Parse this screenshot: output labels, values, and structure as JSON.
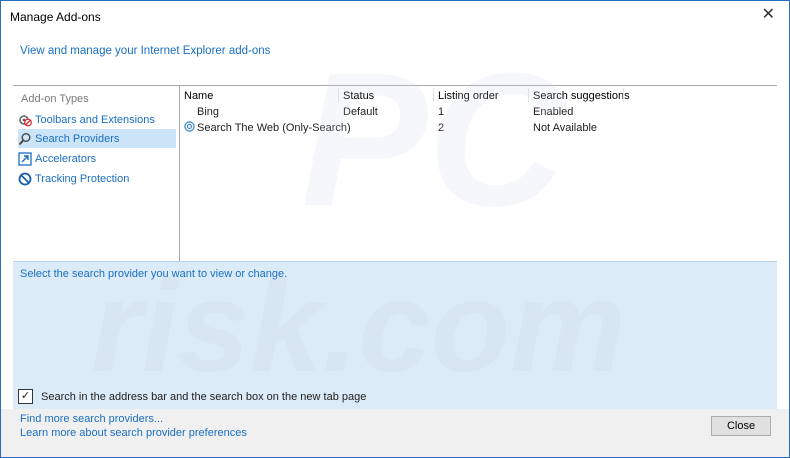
{
  "window": {
    "title": "Manage Add-ons",
    "subtitle": "View and manage your Internet Explorer add-ons"
  },
  "sidebar": {
    "heading": "Add-on Types",
    "items": [
      {
        "label": "Toolbars and Extensions",
        "icon": "gear-block-icon",
        "selected": false
      },
      {
        "label": "Search Providers",
        "icon": "search-icon",
        "selected": true
      },
      {
        "label": "Accelerators",
        "icon": "accelerator-icon",
        "selected": false
      },
      {
        "label": "Tracking Protection",
        "icon": "no-entry-icon",
        "selected": false
      }
    ]
  },
  "list": {
    "columns": [
      "Name",
      "Status",
      "Listing order",
      "Search suggestions"
    ],
    "rows": [
      {
        "name": "Bing",
        "status": "Default",
        "order": "1",
        "suggestions": "Enabled"
      },
      {
        "name": "Search The Web (Only-Search)",
        "status": "",
        "order": "2",
        "suggestions": "Not Available"
      }
    ]
  },
  "details": {
    "hint": "Select the search provider you want to view or change.",
    "checkbox_label": "Search in the address bar and the search box on the new tab page",
    "checkbox_checked": true
  },
  "footer": {
    "link1": "Find more search providers...",
    "link2": "Learn more about search provider preferences",
    "close_label": "Close"
  },
  "colors": {
    "link": "#1a6fc2",
    "selection": "#cce4f7",
    "details_bg": "#dcebf8"
  }
}
